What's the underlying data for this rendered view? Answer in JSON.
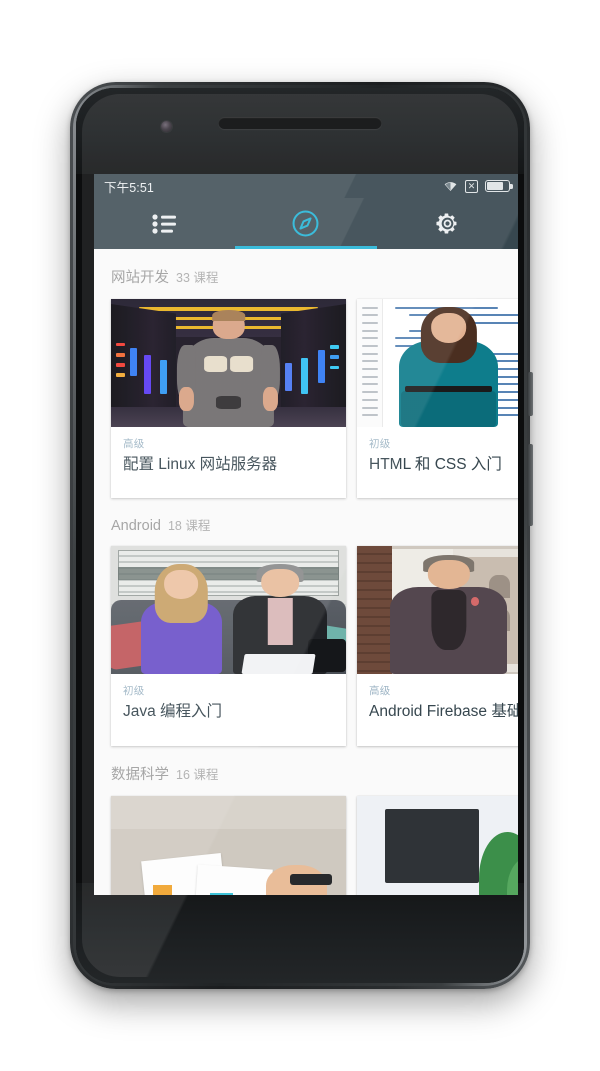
{
  "status_bar": {
    "time": "下午5:51",
    "icons": [
      "wifi-icon",
      "no-sim-icon",
      "battery-icon"
    ],
    "no_sim_glyph": "✕",
    "battery_level_percent": 76,
    "background_color": "#37474f",
    "text_color": "#eceff1"
  },
  "tab_bar": {
    "background_color": "#37474f",
    "active_color": "#29b6d8",
    "inactive_color": "#eceff1",
    "active_index": 1,
    "tabs": [
      {
        "name": "my-courses",
        "icon": "list-icon",
        "active": false
      },
      {
        "name": "discover",
        "icon": "compass-icon",
        "active": true
      },
      {
        "name": "settings",
        "icon": "gear-icon",
        "active": false
      }
    ]
  },
  "content": {
    "background_color": "#fafafa",
    "level_color": "#9fb6c6",
    "title_color": "#37474f",
    "header_color": "#9e9e9e",
    "sections": [
      {
        "title": "网站开发",
        "count": "33 课程",
        "cards": [
          {
            "level": "高级",
            "title": "配置 Linux 网站服务器",
            "image": "data-center-instructor-photo"
          },
          {
            "level": "初级",
            "title": "HTML 和 CSS 入门",
            "image": "html-code-instructors-photo"
          }
        ]
      },
      {
        "title": "Android",
        "count": "18 课程",
        "cards": [
          {
            "level": "初级",
            "title": "Java 编程入门",
            "image": "couch-interview-photo"
          },
          {
            "level": "高级",
            "title": "Android Firebase 基础",
            "image": "award-man-photo"
          }
        ]
      },
      {
        "title": "数据科学",
        "count": "16 课程",
        "cards": [
          {
            "level": "",
            "title": "",
            "image": "desk-charts-photo"
          },
          {
            "level": "",
            "title": "",
            "image": "desk-monitor-plant-photo"
          }
        ]
      }
    ]
  }
}
